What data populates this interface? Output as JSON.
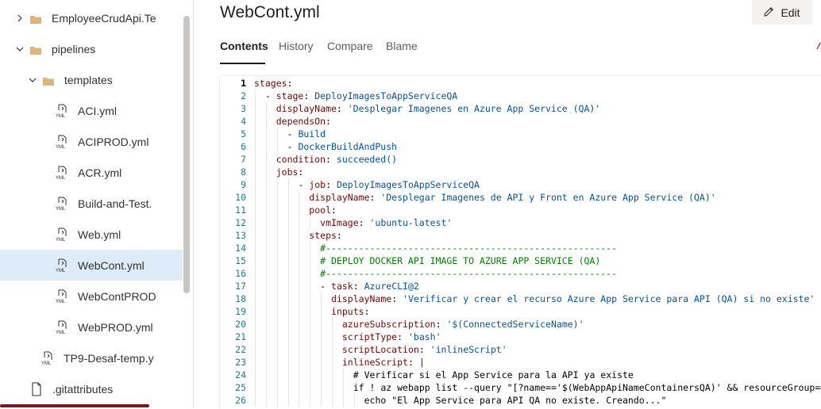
{
  "sidebar": {
    "items": [
      {
        "label": "EmployeeCrudApi.Te",
        "kind": "folder",
        "expanded": false,
        "level": 0
      },
      {
        "label": "pipelines",
        "kind": "folder",
        "expanded": true,
        "level": 0
      },
      {
        "label": "templates",
        "kind": "folder",
        "expanded": true,
        "level": 1
      },
      {
        "label": "ACI.yml",
        "kind": "yml",
        "level": 2
      },
      {
        "label": "ACIPROD.yml",
        "kind": "yml",
        "level": 2
      },
      {
        "label": "ACR.yml",
        "kind": "yml",
        "level": 2
      },
      {
        "label": "Build-and-Test.",
        "kind": "yml",
        "level": 2
      },
      {
        "label": "Web.yml",
        "kind": "yml",
        "level": 2
      },
      {
        "label": "WebCont.yml",
        "kind": "yml",
        "level": 2,
        "selected": true
      },
      {
        "label": "WebContPROD",
        "kind": "yml",
        "level": 2
      },
      {
        "label": "WebPROD.yml",
        "kind": "yml",
        "level": 2
      },
      {
        "label": "TP9-Desaf-temp.y",
        "kind": "yml",
        "level": 1
      },
      {
        "label": ".gitattributes",
        "kind": "file",
        "level": 0
      }
    ]
  },
  "file": {
    "title": "WebCont.yml"
  },
  "toolbar": {
    "edit_label": "Edit",
    "edit_icon": "pencil-icon"
  },
  "tabs": [
    {
      "label": "Contents",
      "active": true
    },
    {
      "label": "History",
      "active": false
    },
    {
      "label": "Compare",
      "active": false
    },
    {
      "label": "Blame",
      "active": false
    }
  ],
  "colors": {
    "selected_bg": "#deecf9",
    "key": "#800000",
    "string": "#0451a5",
    "comment": "#008000",
    "line_number": "#237893"
  },
  "code": {
    "lines": [
      {
        "n": "1",
        "indent": 0,
        "tokens": [
          [
            "k",
            "stages"
          ],
          [
            "p",
            ":"
          ]
        ]
      },
      {
        "n": "2",
        "indent": 1,
        "tokens": [
          [
            "p",
            "- "
          ],
          [
            "k",
            "stage"
          ],
          [
            "p",
            ": "
          ],
          [
            "s",
            "DeployImagesToAppServiceQA"
          ]
        ]
      },
      {
        "n": "3",
        "indent": 2,
        "tokens": [
          [
            "k",
            "displayName"
          ],
          [
            "p",
            ": "
          ],
          [
            "s",
            "'Desplegar Imagenes en Azure App Service (QA)'"
          ]
        ]
      },
      {
        "n": "4",
        "indent": 2,
        "tokens": [
          [
            "k",
            "dependsOn"
          ],
          [
            "p",
            ":"
          ]
        ]
      },
      {
        "n": "5",
        "indent": 3,
        "tokens": [
          [
            "p",
            "- "
          ],
          [
            "s",
            "Build"
          ]
        ]
      },
      {
        "n": "6",
        "indent": 3,
        "tokens": [
          [
            "p",
            "- "
          ],
          [
            "s",
            "DockerBuildAndPush"
          ]
        ]
      },
      {
        "n": "7",
        "indent": 2,
        "tokens": [
          [
            "k",
            "condition"
          ],
          [
            "p",
            ": "
          ],
          [
            "s",
            "succeeded()"
          ]
        ]
      },
      {
        "n": "8",
        "indent": 2,
        "tokens": [
          [
            "k",
            "jobs"
          ],
          [
            "p",
            ":"
          ]
        ]
      },
      {
        "n": "9",
        "indent": 4,
        "tokens": [
          [
            "p",
            "- "
          ],
          [
            "k",
            "job"
          ],
          [
            "p",
            ": "
          ],
          [
            "s",
            "DeployImagesToAppServiceQA"
          ]
        ]
      },
      {
        "n": "10",
        "indent": 5,
        "tokens": [
          [
            "k",
            "displayName"
          ],
          [
            "p",
            ": "
          ],
          [
            "s",
            "'Desplegar Imagenes de API y Front en Azure App Service (QA)'"
          ]
        ]
      },
      {
        "n": "11",
        "indent": 5,
        "tokens": [
          [
            "k",
            "pool"
          ],
          [
            "p",
            ":"
          ]
        ]
      },
      {
        "n": "12",
        "indent": 6,
        "tokens": [
          [
            "k",
            "vmImage"
          ],
          [
            "p",
            ": "
          ],
          [
            "s",
            "'ubuntu-latest'"
          ]
        ]
      },
      {
        "n": "13",
        "indent": 5,
        "tokens": [
          [
            "k",
            "steps"
          ],
          [
            "p",
            ":"
          ]
        ]
      },
      {
        "n": "14",
        "indent": 6,
        "tokens": [
          [
            "c",
            "#-----------------------------------------------------"
          ]
        ]
      },
      {
        "n": "15",
        "indent": 6,
        "tokens": [
          [
            "c",
            "# DEPLOY DOCKER API IMAGE TO AZURE APP SERVICE (QA)"
          ]
        ]
      },
      {
        "n": "16",
        "indent": 6,
        "tokens": [
          [
            "c",
            "#-----------------------------------------------------"
          ]
        ]
      },
      {
        "n": "17",
        "indent": 6,
        "tokens": [
          [
            "p",
            "- "
          ],
          [
            "k",
            "task"
          ],
          [
            "p",
            ": "
          ],
          [
            "s",
            "AzureCLI@2"
          ]
        ]
      },
      {
        "n": "18",
        "indent": 7,
        "tokens": [
          [
            "k",
            "displayName"
          ],
          [
            "p",
            ": "
          ],
          [
            "s",
            "'Verificar y crear el recurso Azure App Service para API (QA) si no existe'"
          ]
        ]
      },
      {
        "n": "19",
        "indent": 7,
        "tokens": [
          [
            "k",
            "inputs"
          ],
          [
            "p",
            ":"
          ]
        ]
      },
      {
        "n": "20",
        "indent": 8,
        "tokens": [
          [
            "k",
            "azureSubscription"
          ],
          [
            "p",
            ": "
          ],
          [
            "s",
            "'$(ConnectedServiceName)'"
          ]
        ]
      },
      {
        "n": "21",
        "indent": 8,
        "tokens": [
          [
            "k",
            "scriptType"
          ],
          [
            "p",
            ": "
          ],
          [
            "s",
            "'bash'"
          ]
        ]
      },
      {
        "n": "22",
        "indent": 8,
        "tokens": [
          [
            "k",
            "scriptLocation"
          ],
          [
            "p",
            ": "
          ],
          [
            "s",
            "'inlineScript'"
          ]
        ]
      },
      {
        "n": "23",
        "indent": 8,
        "tokens": [
          [
            "k",
            "inlineScript"
          ],
          [
            "p",
            ": "
          ],
          [
            "b",
            "|"
          ]
        ]
      },
      {
        "n": "24",
        "indent": 9,
        "tokens": [
          [
            "p",
            "# Verificar si el App Service para la API ya existe"
          ]
        ]
      },
      {
        "n": "25",
        "indent": 9,
        "tokens": [
          [
            "p",
            "if ! az webapp list --query \"[?name=='$(WebAppApiNameContainersQA)' && resourceGroup=='$(ResourceGroupName)']\" | grep -q"
          ]
        ]
      },
      {
        "n": "26",
        "indent": 10,
        "tokens": [
          [
            "p",
            "echo \"El App Service para API QA no existe. Creando...\""
          ]
        ]
      }
    ]
  }
}
